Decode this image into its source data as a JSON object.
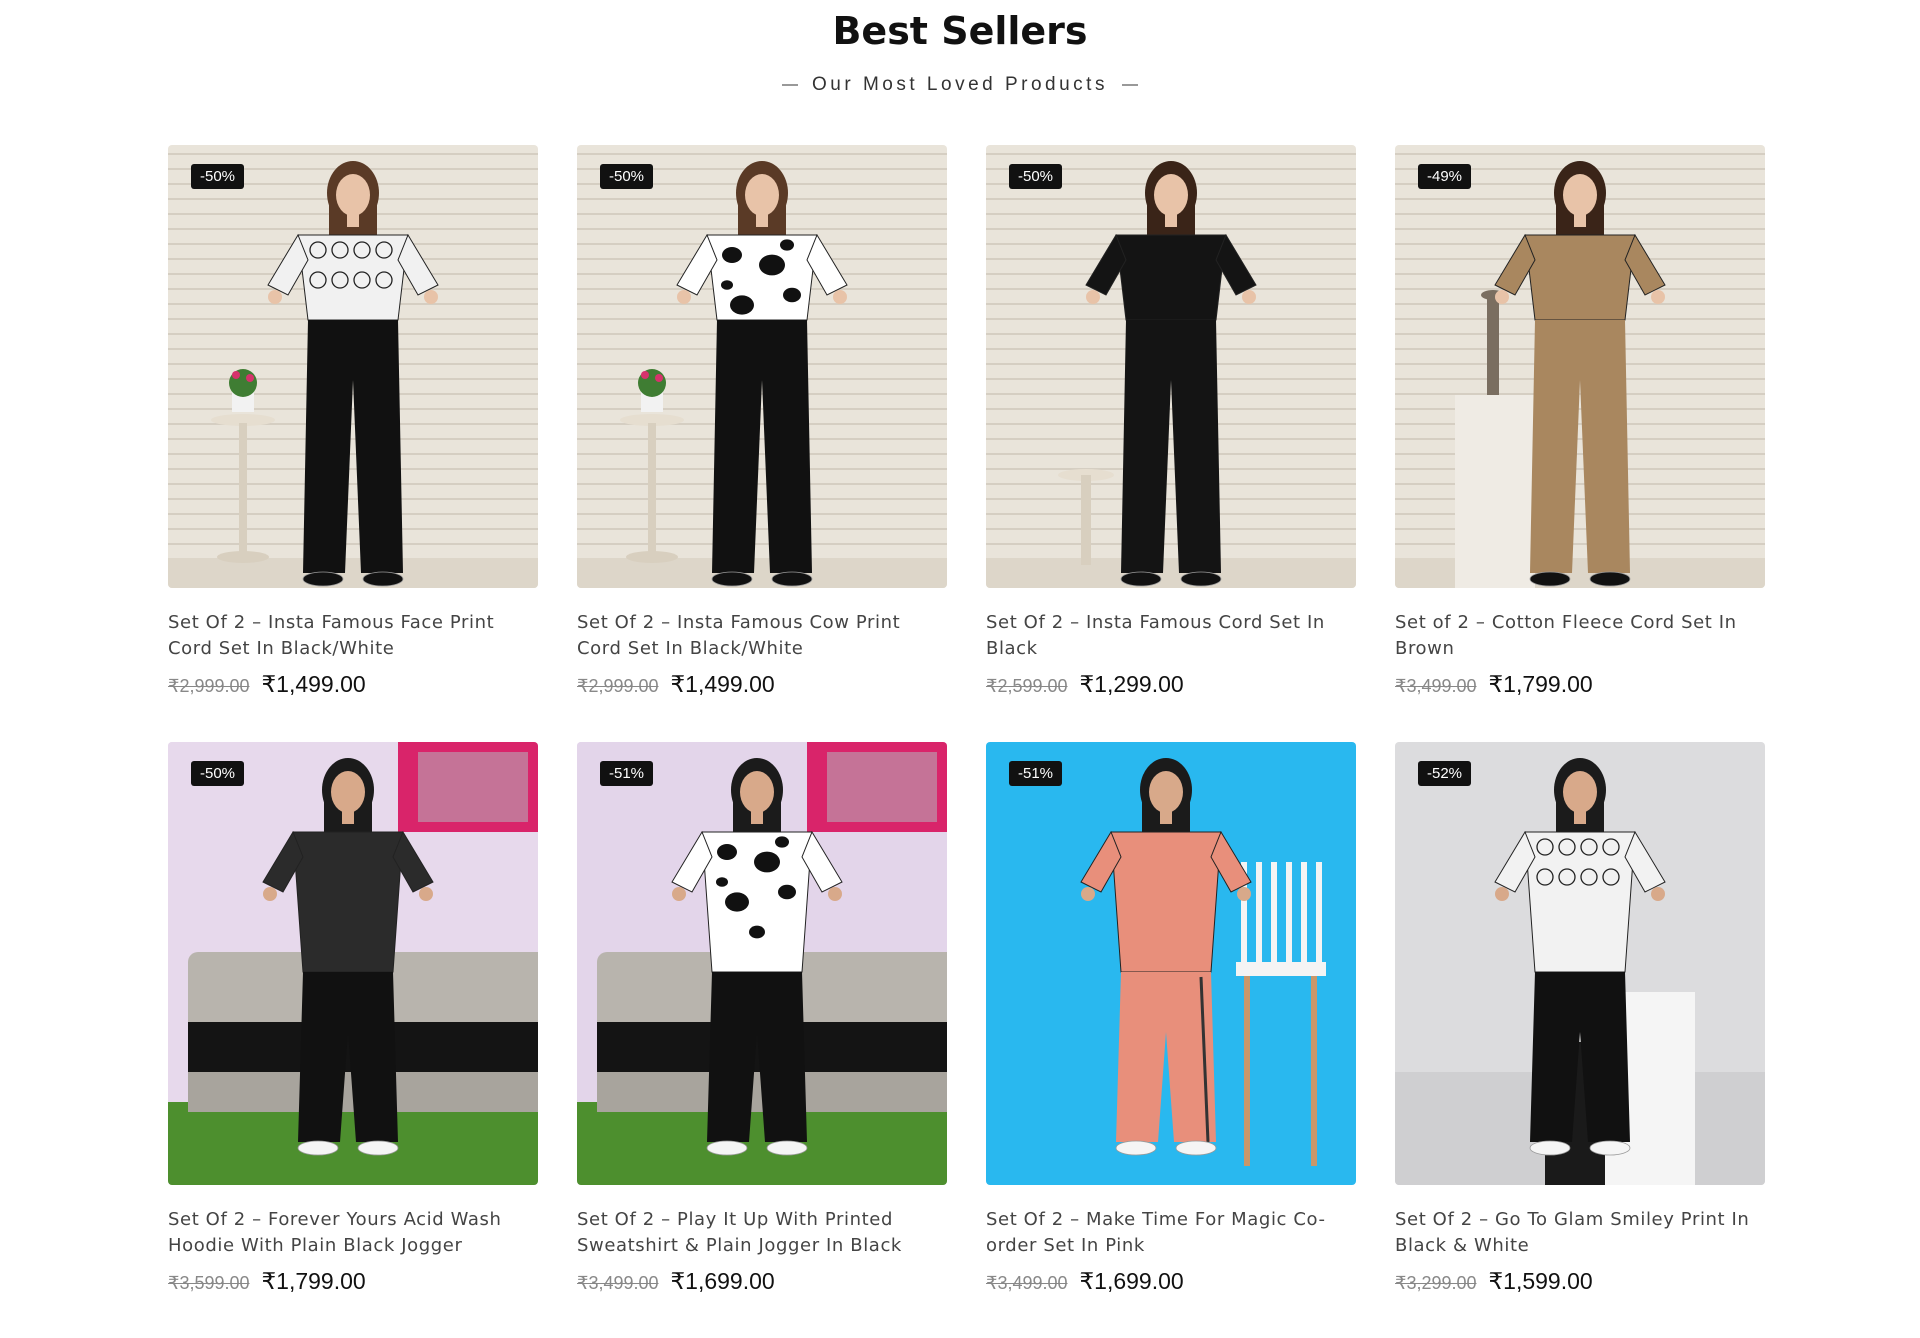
{
  "section": {
    "title": "Best Sellers",
    "subtitle": "Our Most Loved Products"
  },
  "products": [
    {
      "badge": "-50%",
      "title": "Set Of 2 – Insta Famous Face Print Cord Set In Black/White",
      "old_price": "₹2,999.00",
      "price": "₹1,499.00",
      "image": {
        "scene": "striped-wall",
        "bg": "#e9e4da",
        "top": "#f1f1f1",
        "top_pattern": "face-print",
        "bottom": "#111111",
        "skin": "#e8c3a8",
        "hair": "#5a3a26",
        "prop": "plant-table"
      }
    },
    {
      "badge": "-50%",
      "title": "Set Of 2 – Insta Famous Cow Print Cord Set In Black/White",
      "old_price": "₹2,999.00",
      "price": "₹1,499.00",
      "image": {
        "scene": "striped-wall",
        "bg": "#e9e4da",
        "top": "#ffffff",
        "top_pattern": "cow-print",
        "bottom": "#111111",
        "skin": "#e8c3a8",
        "hair": "#5a3a26",
        "prop": "plant-table"
      }
    },
    {
      "badge": "-50%",
      "title": "Set Of 2 – Insta Famous Cord Set In Black",
      "old_price": "₹2,599.00",
      "price": "₹1,299.00",
      "image": {
        "scene": "striped-wall",
        "bg": "#e9e4da",
        "top": "#141414",
        "top_pattern": "plain",
        "bottom": "#141414",
        "skin": "#e8c3a8",
        "hair": "#3a2418",
        "prop": "stool"
      }
    },
    {
      "badge": "-49%",
      "title": "Set of 2 – Cotton Fleece Cord Set In Brown",
      "old_price": "₹3,499.00",
      "price": "₹1,799.00",
      "image": {
        "scene": "striped-wall",
        "bg": "#e9e4da",
        "top": "#a9875f",
        "top_pattern": "plain",
        "bottom": "#a9875f",
        "skin": "#e8c3a8",
        "hair": "#3a2418",
        "prop": "pedestal"
      }
    },
    {
      "badge": "-50%",
      "title": "Set Of 2 – Forever Yours Acid Wash Hoodie With Plain Black Jogger",
      "old_price": "₹3,599.00",
      "price": "₹1,799.00",
      "image": {
        "scene": "sofa",
        "bg": "#e7d9ec",
        "top": "#2b2b2b",
        "top_pattern": "plain",
        "bottom": "#111111",
        "skin": "#d8a98a",
        "hair": "#1b1b1b",
        "prop": "sofa"
      }
    },
    {
      "badge": "-51%",
      "title": "Set Of 2 – Play It Up With Printed Sweatshirt & Plain Jogger In Black",
      "old_price": "₹3,499.00",
      "price": "₹1,699.00",
      "image": {
        "scene": "sofa",
        "bg": "#e3d5ea",
        "top": "#ffffff",
        "top_pattern": "cow-print",
        "bottom": "#111111",
        "skin": "#d8a98a",
        "hair": "#1b1b1b",
        "prop": "sofa"
      }
    },
    {
      "badge": "-51%",
      "title": "Set Of 2 – Make Time For Magic Co-order Set In Pink",
      "old_price": "₹3,499.00",
      "price": "₹1,699.00",
      "image": {
        "scene": "blue",
        "bg": "#29b8ef",
        "top": "#e88f7b",
        "top_pattern": "plain",
        "bottom": "#e88f7b",
        "skin": "#d8a98a",
        "hair": "#1b1b1b",
        "prop": "chair"
      }
    },
    {
      "badge": "-52%",
      "title": "Set Of 2 – Go To Glam Smiley Print In Black & White",
      "old_price": "₹3,299.00",
      "price": "₹1,599.00",
      "image": {
        "scene": "grey",
        "bg": "#dcdcde",
        "top": "#f2f2f2",
        "top_pattern": "face-print",
        "bottom": "#111111",
        "skin": "#d8a98a",
        "hair": "#1b1b1b",
        "prop": "cube"
      }
    }
  ]
}
